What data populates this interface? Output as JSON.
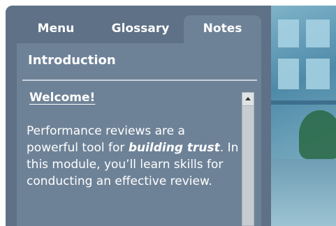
{
  "tabs": [
    {
      "label": "Menu"
    },
    {
      "label": "Glossary"
    },
    {
      "label": "Notes"
    }
  ],
  "active_tab": "Notes",
  "section": {
    "title": "Introduction"
  },
  "note": {
    "heading": "Welcome!",
    "body_part1": "Performance reviews are a powerful tool for ",
    "body_bold": "building trust",
    "body_part2": ". In this module, you’ll learn skills for conducting an effective review."
  },
  "colors": {
    "panel": "#5e7186",
    "active_tab": "#6e8297",
    "text": "#ffffff"
  }
}
